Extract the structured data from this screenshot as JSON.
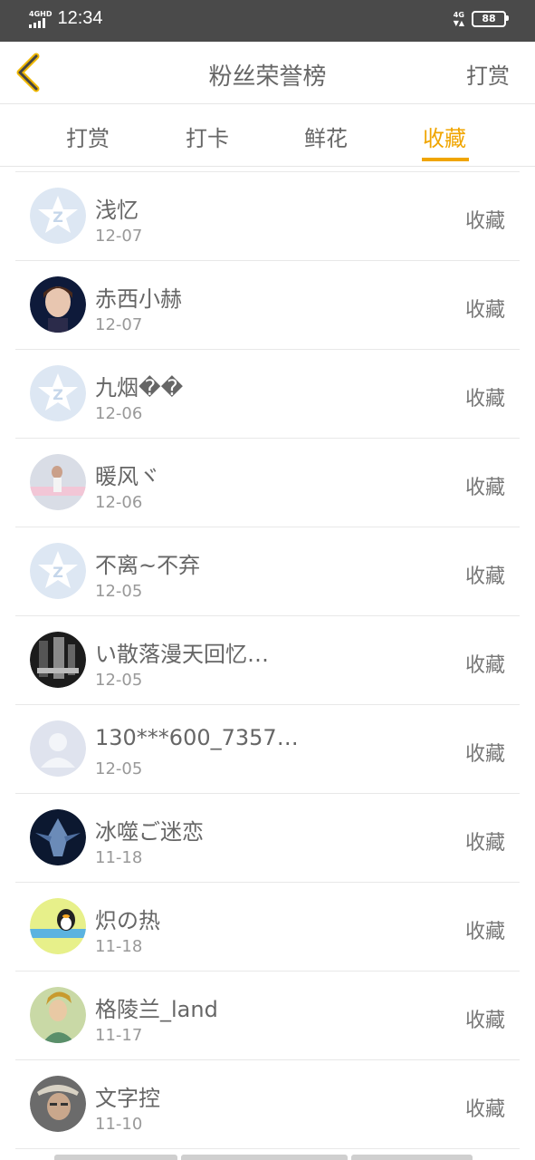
{
  "status_bar": {
    "network_left": "4GHD",
    "time": "12:34",
    "network_right": "4G",
    "battery": "88"
  },
  "header": {
    "back_icon": "chevron-left-icon",
    "title": "粉丝荣誉榜",
    "right_action": "打赏"
  },
  "tabs": [
    {
      "label": "打赏",
      "active": false
    },
    {
      "label": "打卡",
      "active": false
    },
    {
      "label": "鲜花",
      "active": false
    },
    {
      "label": "收藏",
      "active": true
    }
  ],
  "accent_color": "#f0a500",
  "list": [
    {
      "name": "浅忆",
      "date": "12-07",
      "action": "收藏",
      "avatar": "default-z-star-icon"
    },
    {
      "name": "赤西小赫",
      "date": "12-07",
      "action": "收藏",
      "avatar": "photo-avatar"
    },
    {
      "name": "九烟��",
      "date": "12-06",
      "action": "收藏",
      "avatar": "default-z-star-icon"
    },
    {
      "name": "暖风ヾ",
      "date": "12-06",
      "action": "收藏",
      "avatar": "photo-avatar"
    },
    {
      "name": "不离~不弃",
      "date": "12-05",
      "action": "收藏",
      "avatar": "default-z-star-icon"
    },
    {
      "name": "い散落漫天回忆…",
      "date": "12-05",
      "action": "收藏",
      "avatar": "photo-avatar"
    },
    {
      "name": "130***600_7357…",
      "date": "12-05",
      "action": "收藏",
      "avatar": "default-person-icon"
    },
    {
      "name": "冰噬ご迷恋",
      "date": "11-18",
      "action": "收藏",
      "avatar": "photo-avatar"
    },
    {
      "name": "炽の热",
      "date": "11-18",
      "action": "收藏",
      "avatar": "photo-avatar"
    },
    {
      "name": "格陵兰_land",
      "date": "11-17",
      "action": "收藏",
      "avatar": "photo-avatar"
    },
    {
      "name": "文字控",
      "date": "11-10",
      "action": "收藏",
      "avatar": "photo-avatar"
    }
  ]
}
